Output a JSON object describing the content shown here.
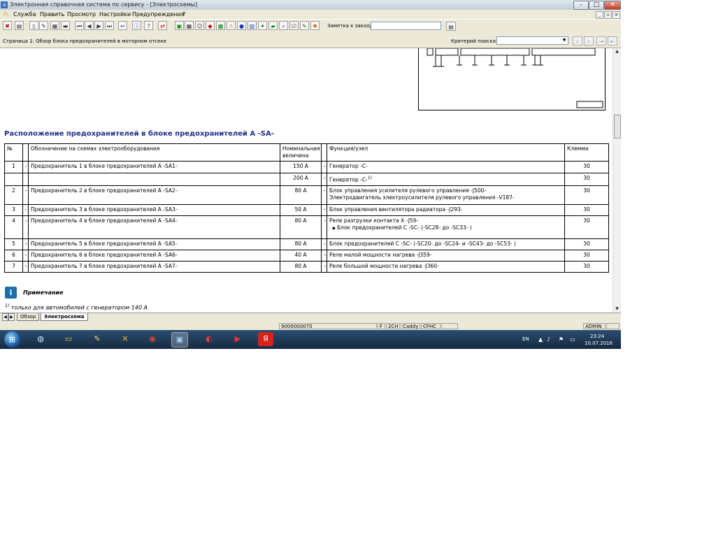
{
  "window": {
    "title": "Электронная справочная система по сервису - [Электросхемы]",
    "icon_label": "a"
  },
  "menu": {
    "items": [
      "Служба",
      "Править",
      "Просмотр",
      "Настройки",
      "Предупреждения",
      "?"
    ]
  },
  "toolbar": {
    "order_label": "Заметка к заказу:",
    "order_value": ""
  },
  "infobar": {
    "page_title": "Страница 1: Обзор блока предохранителей в моторном отсеке",
    "search_label": "Критерий поиска:",
    "search_value": ""
  },
  "content": {
    "heading": "Расположение предохранителей в блоке предохранителей A -SA-",
    "table": {
      "headers": {
        "no": "№",
        "designation": "Обозначение на схемах электрооборудования",
        "rating": "Номинальная величина",
        "function": "Функция/узел",
        "terminal": "Клемма"
      },
      "rows": [
        {
          "no": "1",
          "dash1": "-",
          "designation": "Предохранитель 1 в блоке предохранителей A -SA1-",
          "rating": "150 A",
          "dash2": "-",
          "function": "Генератор -C-",
          "terminal": "30"
        },
        {
          "no": "",
          "dash1": "",
          "designation": "",
          "rating": "200 A",
          "dash2": "-",
          "function": "Генератор -C-",
          "sup": "1)",
          "terminal": "30"
        },
        {
          "no": "2",
          "dash1": "-",
          "designation": "Предохранитель 2 в блоке предохранителей A -SA2-",
          "rating": "80 A",
          "dash2": "-",
          "function": "Блок управления усилителя рулевого управления -J500-",
          "function2": "Электродвигатель электроусилителя рулевого управления -V187-",
          "terminal": "30"
        },
        {
          "no": "3",
          "dash1": "-",
          "designation": "Предохранитель 3 в блоке предохранителей A -SA3-",
          "rating": "50 A",
          "dash2": "-",
          "function": "Блок управления вентилятора радиатора -J293-",
          "terminal": "30"
        },
        {
          "no": "4",
          "dash1": "-",
          "designation": "Предохранитель 4 в блоке предохранителей A -SA4-",
          "rating": "80 A",
          "dash2": "-",
          "function": "Реле разгрузки контакта X -J59-",
          "bullet": "◆",
          "function2": "Блок предохранителей C -SC- (-SC28- до -SC33- )",
          "terminal": "30"
        },
        {
          "no": "5",
          "dash1": "-",
          "designation": "Предохранитель 5 в блоке предохранителей A -SA5-",
          "rating": "80 A",
          "dash2": "-",
          "function": "Блок предохранителей C -SC- (-SC20- до -SC24- и -SC43- до -SC53- )",
          "terminal": "30"
        },
        {
          "no": "6",
          "dash1": "-",
          "designation": "Предохранитель 6 в блоке предохранителей A -SA6-",
          "rating": "40 A",
          "dash2": "-",
          "function": "Реле малой мощности нагрева -J359-",
          "terminal": "30"
        },
        {
          "no": "7",
          "dash1": "-",
          "designation": "Предохранитель 7 в блоке предохранителей A -SA7-",
          "rating": "80 A",
          "dash2": "-",
          "function": "Реле большой мощности нагрева -J360-",
          "terminal": "30"
        }
      ]
    },
    "note_title": "Примечание",
    "note_sup": "1)",
    "note_text": "только для автомобилей с генератором 140 A"
  },
  "tabs": [
    {
      "label": "Обзор",
      "active": false
    },
    {
      "label": "Электросхема",
      "active": true
    }
  ],
  "status": {
    "code": "9000000070",
    "f": "F",
    "engine": "2CH",
    "model": "Caddy",
    "engine2": "CFHC",
    "user": "ADMIN"
  },
  "taskbar": {
    "lang": "EN",
    "time": "23:24",
    "date": "10.07.2016"
  },
  "colors": {
    "heading": "#1f2f8a",
    "taskbar": "#1c3553"
  }
}
